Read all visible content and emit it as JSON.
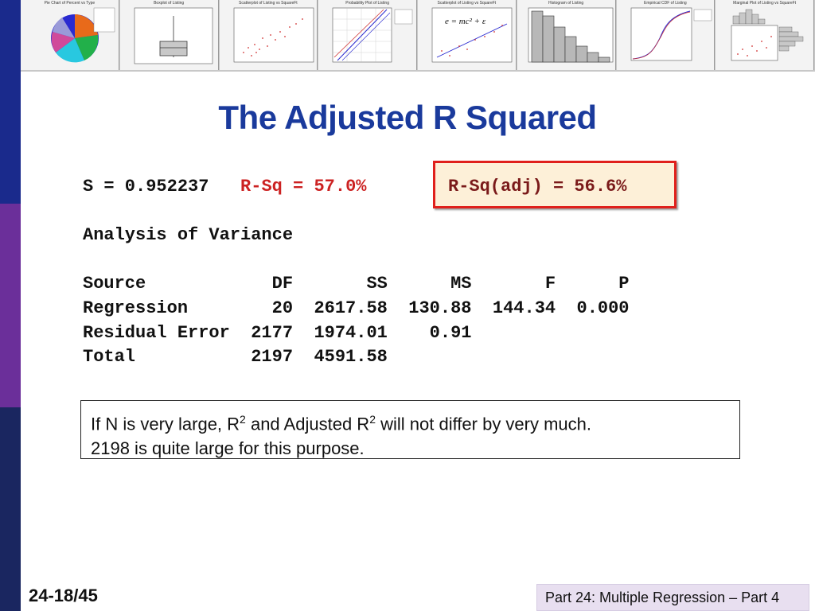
{
  "thumbnails": [
    {
      "title": "Pie Chart of Percent vs Type"
    },
    {
      "title": "Boxplot of Listing"
    },
    {
      "title": "Scatterplot of Listing vs SquareFt"
    },
    {
      "title": "Probability Plot of Listing"
    },
    {
      "title": "Scatterplot of Listing vs SquareFt",
      "formula": "e = mc² + ε"
    },
    {
      "title": "Histogram of Listing"
    },
    {
      "title": "Empirical CDF of Listing"
    },
    {
      "title": "Marginal Plot of Listing vs SquareFt"
    }
  ],
  "slide": {
    "title": "The Adjusted R Squared",
    "stats": {
      "s": "S = 0.952237",
      "rsq": "R-Sq = 57.0%",
      "rsq_adj": "R-Sq(adj) = 56.6%"
    },
    "anova": {
      "heading": "Analysis of Variance",
      "header": "Source            DF       SS      MS       F      P",
      "rows": [
        "Regression        20  2617.58  130.88  144.34  0.000",
        "Residual Error  2177  1974.01    0.91",
        "Total           2197  4591.58"
      ]
    },
    "note": {
      "line1_a": "If N is very large, R",
      "line1_sup1": "2",
      "line1_b": " and Adjusted R",
      "line1_sup2": "2",
      "line1_c": " will not differ by very much.",
      "line2": "2198 is quite large for this purpose."
    }
  },
  "footer": {
    "slide_number": "24-18/45",
    "caption": "Part 24: Multiple Regression – Part 4"
  },
  "colors": {
    "title": "#1a3a9c",
    "rsq": "#cc2222",
    "adj_border": "#e0201c",
    "adj_fill": "#fdf0d8"
  }
}
